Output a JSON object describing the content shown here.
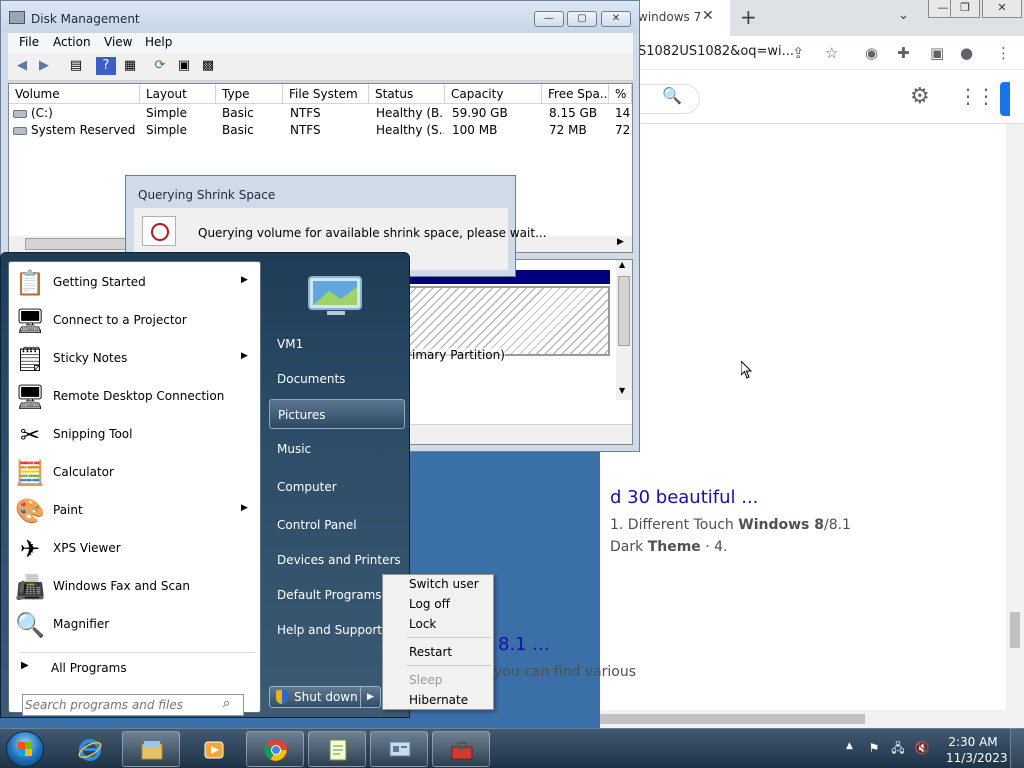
{
  "chrome": {
    "tab_title": "windows 7",
    "tab_close": "✕",
    "new_tab": "+",
    "tab_search": "⌄",
    "window_controls": [
      "—",
      "❐",
      "✕"
    ],
    "url": "S1082US1082&oq=wi...",
    "results": [
      {
        "title": "d 30 beautiful ...",
        "snippet1_pre": "1. Different Touch ",
        "snippet1_b1": "Windows 8",
        "snippet1_post": "/8.1",
        "snippet2_pre": "Dark ",
        "snippet2_b": "Theme",
        "snippet2_post": " · 4."
      },
      {
        "title": "8.1 ...",
        "snippet": "you can find various"
      }
    ]
  },
  "disk_management": {
    "title": "Disk Management",
    "menu": [
      "File",
      "Action",
      "View",
      "Help"
    ],
    "columns": [
      "Volume",
      "Layout",
      "Type",
      "File System",
      "Status",
      "Capacity",
      "Free Spa...",
      "% F"
    ],
    "rows": [
      [
        "(C:)",
        "Simple",
        "Basic",
        "NTFS",
        "Healthy (B...",
        "59.90 GB",
        "8.15 GB",
        "14"
      ],
      [
        "System Reserved",
        "Simple",
        "Basic",
        "NTFS",
        "Healthy (S...",
        "100 MB",
        "72 MB",
        "72"
      ]
    ],
    "partition_label": "imary Partition)"
  },
  "shrink_dialog": {
    "title": "Querying Shrink Space",
    "message": "Querying volume for available shrink space, please wait..."
  },
  "start_menu": {
    "programs": [
      {
        "label": "Getting Started",
        "icon": "getting-started-icon",
        "glyph": "📋",
        "arrow": true
      },
      {
        "label": "Connect to a Projector",
        "icon": "projector-icon",
        "glyph": "🖥",
        "arrow": false
      },
      {
        "label": "Sticky Notes",
        "icon": "sticky-notes-icon",
        "glyph": "🗒",
        "arrow": true
      },
      {
        "label": "Remote Desktop Connection",
        "icon": "remote-desktop-icon",
        "glyph": "🖥",
        "arrow": false
      },
      {
        "label": "Snipping Tool",
        "icon": "scissors-icon",
        "glyph": "✂",
        "arrow": false
      },
      {
        "label": "Calculator",
        "icon": "calculator-icon",
        "glyph": "🧮",
        "arrow": false
      },
      {
        "label": "Paint",
        "icon": "paint-palette-icon",
        "glyph": "🎨",
        "arrow": true
      },
      {
        "label": "XPS Viewer",
        "icon": "xps-viewer-icon",
        "glyph": "✈",
        "arrow": false
      },
      {
        "label": "Windows Fax and Scan",
        "icon": "fax-icon",
        "glyph": "📠",
        "arrow": false
      },
      {
        "label": "Magnifier",
        "icon": "magnifier-icon",
        "glyph": "🔍",
        "arrow": false
      }
    ],
    "all_programs": "All Programs",
    "search_placeholder": "Search programs and files",
    "right_items": [
      "VM1",
      "Documents",
      "Pictures",
      "Music",
      "Computer",
      "Control Panel",
      "Devices and Printers",
      "Default Programs",
      "Help and Support"
    ],
    "shutdown_label": "Shut down"
  },
  "shutdown_flyout": {
    "items": [
      {
        "label": "Switch user",
        "enabled": true
      },
      {
        "label": "Log off",
        "enabled": true
      },
      {
        "label": "Lock",
        "enabled": true
      },
      {
        "label": "Restart",
        "enabled": true
      },
      {
        "label": "Sleep",
        "enabled": false
      },
      {
        "label": "Hibernate",
        "enabled": true
      }
    ]
  },
  "taskbar": {
    "apps": [
      "internet-explorer-icon",
      "windows-explorer-icon",
      "media-player-icon",
      "chrome-icon",
      "notepad-icon",
      "disk-management-icon",
      "toolbox-icon"
    ],
    "clock_time": "2:30 AM",
    "clock_date": "11/3/2023"
  },
  "colors": {
    "link": "#1a0dab",
    "partition_bar": "#00007f",
    "start_menu_bg": "#2d4d68"
  }
}
